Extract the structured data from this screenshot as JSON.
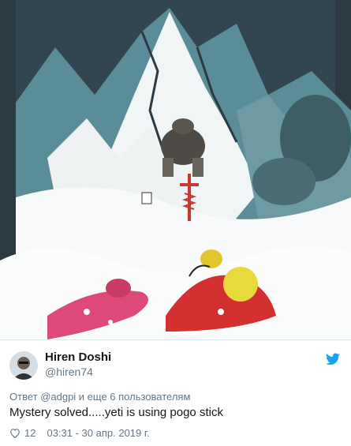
{
  "media": {
    "icon": "cartoon-image",
    "description_hidden": ""
  },
  "author": {
    "display_name": "Hiren Doshi",
    "handle": "@hiren74",
    "avatar_icon": "avatar-icon"
  },
  "brand": {
    "icon": "twitter-bird-icon",
    "color": "#1da1f2"
  },
  "tweet": {
    "reply_to": "Ответ @adgpi и еще 6 пользователям",
    "text": "Mystery solved.....yeti is using pogo stick",
    "like_count": "12",
    "timestamp": "03:31 - 30 апр. 2019 г."
  },
  "colors": {
    "text": "#14171a",
    "secondary": "#657786",
    "sky": "#2e3f48",
    "snow": "#f7f9fa",
    "rock": "#4f7f8a",
    "climber_red": "#d2312f",
    "climber_pink": "#dd4a79",
    "backpack_yellow": "#e8d93d"
  }
}
